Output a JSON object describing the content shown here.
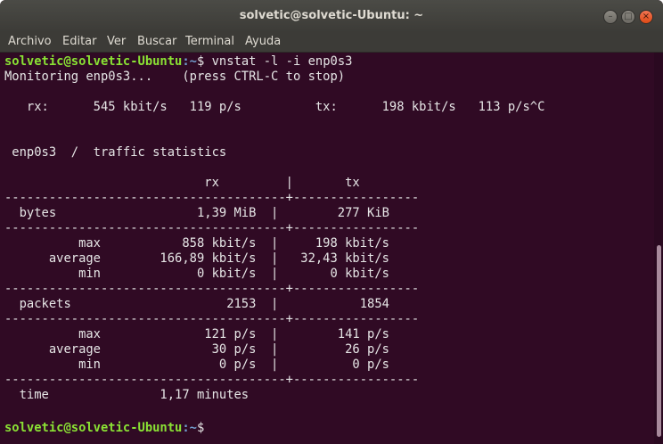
{
  "window": {
    "title": "solvetic@solvetic-Ubuntu: ~",
    "minimize_glyph": "–",
    "maximize_glyph": "□",
    "close_glyph": "×"
  },
  "menu": {
    "items": [
      "Archivo",
      "Editar",
      "Ver",
      "Buscar",
      "Terminal",
      "Ayuda"
    ]
  },
  "terminal": {
    "prompt_user": "solvetic@solvetic-Ubuntu",
    "prompt_path": ":~",
    "prompt_suffix": "$",
    "command": " vnstat -l -i enp0s3",
    "lines": [
      "Monitoring enp0s3...    (press CTRL-C to stop)",
      "",
      "   rx:      545 kbit/s   119 p/s          tx:      198 kbit/s   113 p/s^C",
      "",
      "",
      " enp0s3  /  traffic statistics",
      "",
      "                           rx         |       tx",
      "--------------------------------------+-----------------",
      "  bytes                   1,39 MiB  |        277 KiB",
      "--------------------------------------+-----------------",
      "          max           858 kbit/s  |     198 kbit/s",
      "      average        166,89 kbit/s  |   32,43 kbit/s",
      "          min             0 kbit/s  |       0 kbit/s",
      "--------------------------------------+-----------------",
      "  packets                     2153  |           1854",
      "--------------------------------------+-----------------",
      "          max              121 p/s  |        141 p/s",
      "      average               30 p/s  |         26 p/s",
      "          min                0 p/s  |          0 p/s",
      "--------------------------------------+-----------------",
      "  time               1,17 minutes",
      ""
    ]
  }
}
